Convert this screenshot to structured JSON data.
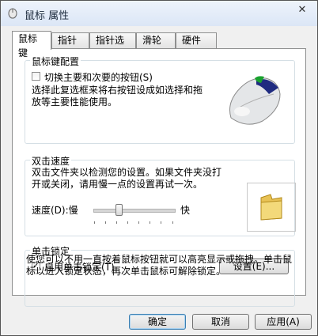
{
  "window": {
    "title": "鼠标 属性",
    "close_glyph": "✕"
  },
  "tabs": [
    {
      "label": "鼠标键",
      "active": true
    },
    {
      "label": "指针"
    },
    {
      "label": "指针选项"
    },
    {
      "label": "滑轮"
    },
    {
      "label": "硬件"
    }
  ],
  "button_config": {
    "title": "鼠标键配置",
    "switch_label": "切换主要和次要的按钮(S)",
    "switch_checked": false,
    "description": "选择此复选框来将右按钮设成如选择和拖放等主要性能使用。"
  },
  "double_click": {
    "title": "双击速度",
    "description": "双击文件夹以检测您的设置。如果文件夹没打开或关闭，请用慢一点的设置再试一次。",
    "speed_label": "速度(D):慢",
    "fast_label": "快",
    "speed_level_percent": 33
  },
  "click_lock": {
    "title": "单击锁定",
    "enable_label": "启用单击锁定(T)",
    "enable_checked": true,
    "settings_label": "设置(E)...",
    "description": "使您可以不用一直按着鼠标按钮就可以高亮显示或拖拽。单击鼠标以进入锁定状态，再次单击鼠标可解除锁定。"
  },
  "footer": {
    "ok": "确定",
    "cancel": "取消",
    "apply": "应用(A)"
  },
  "icons": {
    "title": "mouse-icon",
    "close": "close-icon",
    "mouse_image": "mouse-image",
    "folder": "folder-icon"
  }
}
